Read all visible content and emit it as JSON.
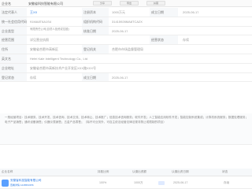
{
  "header": {
    "label": "企业名",
    "company": "安徽省科技智能有限公司",
    "tools": [
      "分享",
      "导出",
      "纠错"
    ]
  },
  "info": [
    {
      "label": "法定代表人",
      "value": "王XX"
    },
    {
      "label": "统一社会信用代码",
      "value": "91MA8T6A1S4"
    },
    {
      "label": "企业类型",
      "value": "有限责任公司(自然人投资或控股)"
    },
    {
      "label": "经营范围",
      "value": "详见营业执照"
    },
    {
      "label": "住所",
      "value": "安徽省合肥市高新区"
    },
    {
      "label": "登记机关",
      "value": "合肥市市场监督管理局"
    },
    {
      "label": "英文名",
      "value": "Hefei Kale Intelligent Technology Co., Ltd"
    },
    {
      "label": "企业地址",
      "value": "安徽省合肥市高新技术产业开发区XXX路XXX号"
    },
    {
      "label": "经营状态",
      "value": "存续"
    },
    {
      "label": "注册资本",
      "value": "1000万元"
    },
    {
      "label": "成立日期",
      "value": "2025-06-17"
    },
    {
      "label": "登记状态",
      "value": "存续"
    }
  ],
  "right_info": [
    {
      "label": "成立日期",
      "value": "2025-06-17"
    },
    {
      "label": "组织机构代码",
      "value": "31415926MA8TCA2X"
    },
    {
      "label": "核准日期",
      "value": "2025-06-17"
    }
  ],
  "description": "一般经营项目：技术服务、技术开发、技术咨询、技术交流、技术转让、技术推广；信息技术咨询服务；软件开发；人工智能应用软件开发；智能控制系统集成；计算机系统服务；数据处理服务；电子产品销售；通讯设备销售；仪器仪表销售；五金产品零售；（除许可业务外，可自主依法经营法律法规非禁止或限制的项目）",
  "bottom": {
    "headers": [
      "企业名称",
      "持股比例",
      "认缴出资额",
      "认缴出资日期",
      "状态"
    ],
    "row": {
      "name": "安徽省科技智能有限公司",
      "sub": "查看详情 1246563156",
      "percent": "100%",
      "amount": "1000万",
      "date": "2025-06-17",
      "status": "存续"
    }
  }
}
